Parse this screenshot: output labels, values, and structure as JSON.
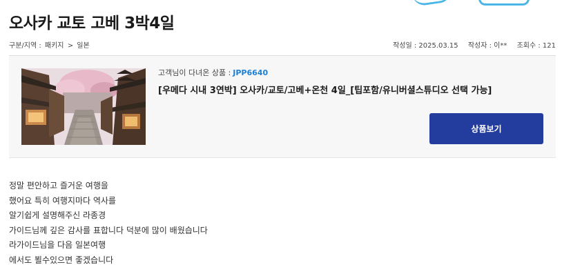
{
  "post": {
    "title": "오사카 교토 고베 3박4일",
    "breadcrumb": {
      "label": "구분/지역 :",
      "category": "패키지",
      "separator": ">",
      "region": "일본"
    },
    "meta": {
      "date": "작성일 : 2025.03.15",
      "author": "작성자 : 이**",
      "views": "조회수 : 121"
    },
    "body_lines": [
      "정말 편안하고 즐거운 여행을",
      "했어요 특히 여행지마다 역사를",
      "알기쉽게 설명해주신 라종경",
      "가이드님께 깊은 감사를 표합니다 덕분에 많이 배웠습니다",
      "라가이드님을 다음 일본여행",
      "에서도 뵐수있으면 좋겠습니다"
    ]
  },
  "product": {
    "caption": "고객님이 다녀온 상품 :",
    "code": "JPP6640",
    "name": "[우메다 시내 3연박] 오사카/교토/고베+온천 4일_[팁포함/유니버셜스튜디오 선택 가능]",
    "button_label": "상품보기",
    "image_icon": "kyoto-street-photo"
  },
  "colors": {
    "accent_button": "#233d9e",
    "product_code": "#1c7fd6",
    "decoration": "#4ab6e8"
  }
}
